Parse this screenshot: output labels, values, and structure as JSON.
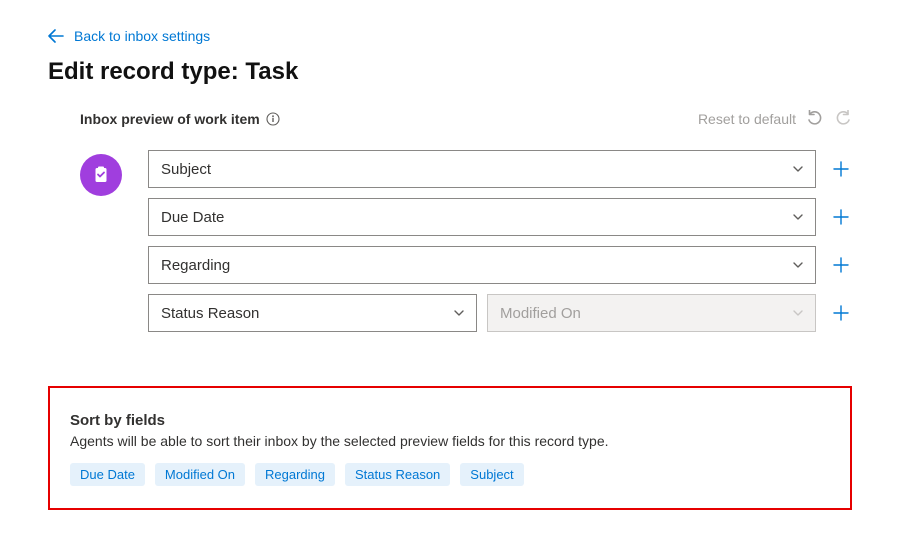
{
  "back_link": "Back to inbox settings",
  "page_title": "Edit record type: Task",
  "preview": {
    "section_label": "Inbox preview of work item",
    "reset_label": "Reset to default",
    "rows": [
      {
        "value": "Subject"
      },
      {
        "value": "Due Date"
      },
      {
        "value": "Regarding"
      }
    ],
    "pair": {
      "left": "Status Reason",
      "right": "Modified On"
    }
  },
  "sort": {
    "title": "Sort by fields",
    "description": "Agents will be able to sort their inbox by the selected preview fields for this record type.",
    "chips": [
      "Due Date",
      "Modified On",
      "Regarding",
      "Status Reason",
      "Subject"
    ]
  }
}
